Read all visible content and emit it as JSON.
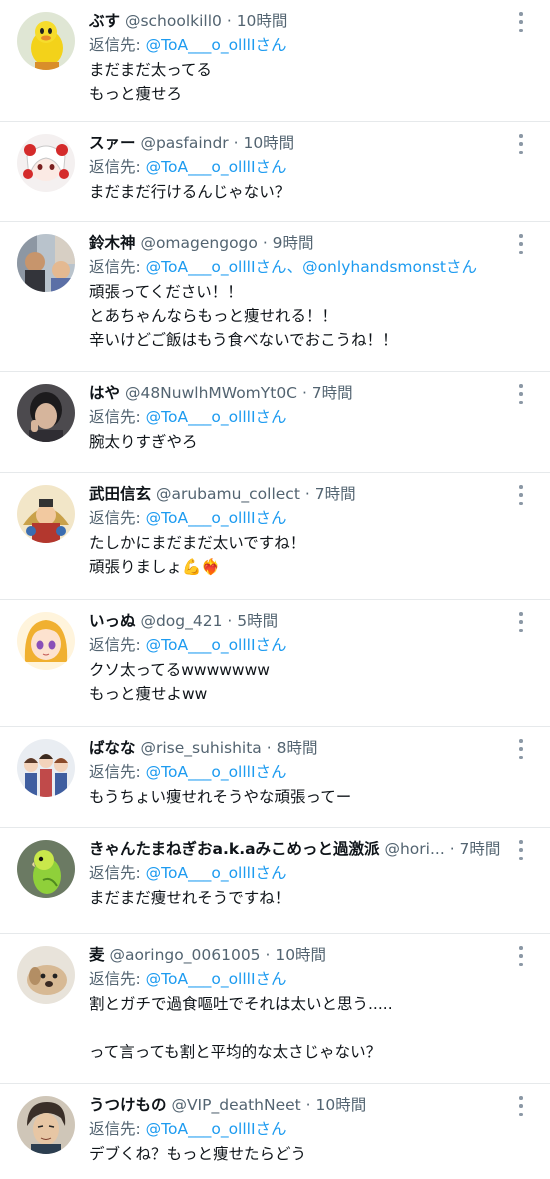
{
  "replies": [
    {
      "name": "ぶす",
      "handle": "@schoolkill0",
      "time": "10時間",
      "reply_label": "返信先:",
      "mentions": [
        "@ToA___o_olllIさん"
      ],
      "lines": [
        "まだまだ太ってる",
        "もっと痩せろ"
      ],
      "avatar_icon": "yellow-character-avatar"
    },
    {
      "name": "スァー",
      "handle": "@pasfaindr",
      "time": "10時間",
      "reply_label": "返信先:",
      "mentions": [
        "@ToA___o_olllIさん"
      ],
      "lines": [
        "まだまだ行けるんじゃない？"
      ],
      "avatar_icon": "anime-girl-red-bows-avatar"
    },
    {
      "name": "鈴木神",
      "handle": "@omagengogo",
      "time": "9時間",
      "reply_label": "返信先:",
      "mentions": [
        "@ToA___o_olllIさん",
        "@onlyhandsmonstさん"
      ],
      "lines": [
        "頑張ってください！！",
        "とあちゃんならもっと痩せれる！！",
        "辛いけどご飯はもう食べないでおこうね！！"
      ],
      "avatar_icon": "photo-street-avatar"
    },
    {
      "name": "はや",
      "handle": "@48NuwlhMWomYt0C",
      "time": "7時間",
      "reply_label": "返信先:",
      "mentions": [
        "@ToA___o_olllIさん"
      ],
      "lines": [
        "腕太りすぎやろ"
      ],
      "avatar_icon": "photo-person-avatar"
    },
    {
      "name": "武田信玄",
      "handle": "@arubamu_collect",
      "time": "7時間",
      "reply_label": "返信先:",
      "mentions": [
        "@ToA___o_olllIさん"
      ],
      "lines": [
        "たしかにまだまだ太いですね！",
        "頑張りましょ💪❤️‍🔥"
      ],
      "avatar_icon": "samurai-illustration-avatar"
    },
    {
      "name": "いっぬ",
      "handle": "@dog_421",
      "time": "5時間",
      "reply_label": "返信先:",
      "mentions": [
        "@ToA___o_olllIさん"
      ],
      "lines": [
        "クソ太ってるwwwwwww",
        "もっと痩せよww"
      ],
      "avatar_icon": "anime-girl-avatar"
    },
    {
      "name": "ばなな",
      "handle": "@rise_suhishita",
      "time": "8時間",
      "reply_label": "返信先:",
      "mentions": [
        "@ToA___o_olllIさん"
      ],
      "lines": [
        "もうちょい痩せれそうやな頑張ってー"
      ],
      "avatar_icon": "anime-group-avatar"
    },
    {
      "name": "きゃんたまねぎおa.k.aみこめっと過激派",
      "handle": "@hori...",
      "time": "7時間",
      "reply_label": "返信先:",
      "mentions": [
        "@ToA___o_olllIさん"
      ],
      "lines": [
        "まだまだ痩せれそうですね！"
      ],
      "avatar_icon": "green-parakeet-avatar"
    },
    {
      "name": "麦",
      "handle": "@aoringo_0061005",
      "time": "10時間",
      "reply_label": "返信先:",
      "mentions": [
        "@ToA___o_olllIさん"
      ],
      "lines": [
        "割とガチで過食嘔吐でそれは太いと思う.....",
        "",
        "って言っても割と平均的な太さじゃない？"
      ],
      "avatar_icon": "dog-avatar"
    },
    {
      "name": "うつけもの",
      "handle": "@VIP_deathNeet",
      "time": "10時間",
      "reply_label": "返信先:",
      "mentions": [
        "@ToA___o_olllIさん"
      ],
      "lines": [
        "デブくね？もっと痩せたらどう"
      ],
      "avatar_icon": "anime-man-avatar"
    }
  ],
  "dot": "·",
  "mention_sep": "、",
  "colors": {
    "link": "#1d9bf0",
    "muted": "#536471",
    "text": "#0f1419",
    "divider": "#e6e9eb"
  }
}
